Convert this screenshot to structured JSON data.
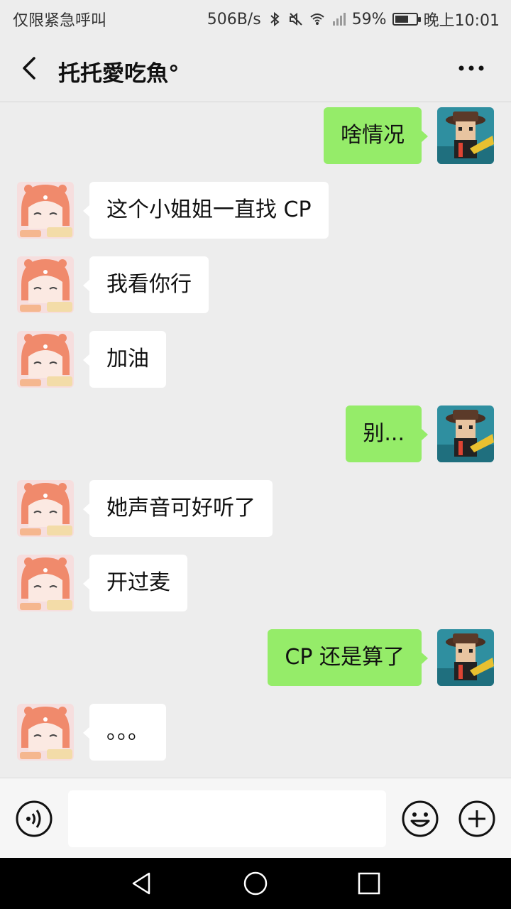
{
  "status_bar": {
    "carrier": "仅限紧急呼叫",
    "net_speed": "506B/s",
    "battery": "59%",
    "battery_level": 0.59,
    "time": "晚上10:01",
    "icons": [
      "bluetooth-icon",
      "mute-icon",
      "wifi-icon",
      "signal-icon",
      "battery-icon"
    ]
  },
  "header": {
    "title": "托托愛吃魚°",
    "back_icon": "chevron-left-icon",
    "more_icon": "more-dots-icon"
  },
  "messages": [
    {
      "side": "out",
      "text": "啥情况"
    },
    {
      "side": "in",
      "text": "这个小姐姐一直找 CP"
    },
    {
      "side": "in",
      "text": "我看你行"
    },
    {
      "side": "in",
      "text": "加油"
    },
    {
      "side": "out",
      "text": "别..."
    },
    {
      "side": "in",
      "text": "她声音可好听了"
    },
    {
      "side": "in",
      "text": "开过麦"
    },
    {
      "side": "out",
      "text": "CP 还是算了"
    },
    {
      "side": "in",
      "text": "。。。"
    }
  ],
  "input_bar": {
    "value": "",
    "voice_icon": "voice-icon",
    "emoji_icon": "emoji-icon",
    "plus_icon": "plus-icon"
  },
  "system_nav": {
    "icons": [
      "back-triangle-icon",
      "home-circle-icon",
      "recents-square-icon"
    ]
  },
  "colors": {
    "background": "#ededed",
    "outgoing_bubble": "#95ec69",
    "incoming_bubble": "#ffffff"
  }
}
